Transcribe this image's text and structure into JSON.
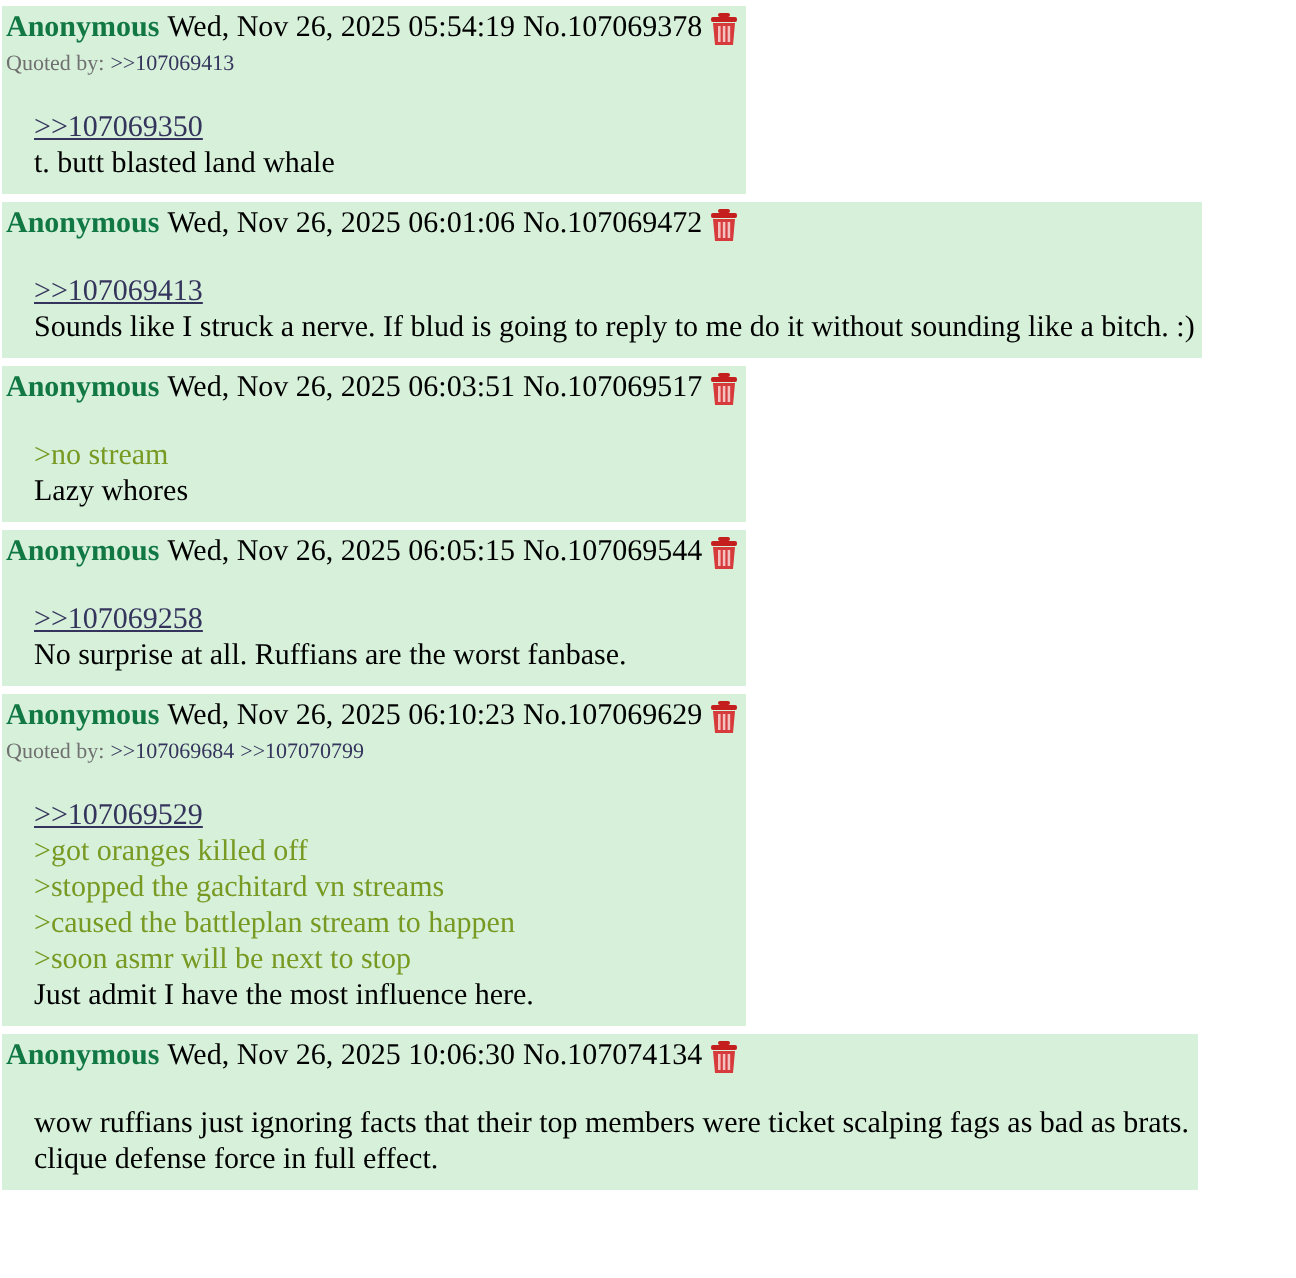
{
  "posts": [
    {
      "name": "Anonymous",
      "date": "Wed, Nov 26, 2025 05:54:19",
      "number": "No.107069378",
      "quoted_by_label": "Quoted by:",
      "quoted_by": [
        ">>107069413"
      ],
      "body": [
        {
          "kind": "quotelink",
          "text": ">>107069350"
        },
        {
          "kind": "text",
          "text": "t. butt blasted land whale"
        }
      ]
    },
    {
      "name": "Anonymous",
      "date": "Wed, Nov 26, 2025 06:01:06",
      "number": "No.107069472",
      "body": [
        {
          "kind": "quotelink",
          "text": ">>107069413"
        },
        {
          "kind": "text",
          "text": "Sounds like I struck a nerve. If blud is going to reply to me do it without sounding like a bitch. :)"
        }
      ]
    },
    {
      "name": "Anonymous",
      "date": "Wed, Nov 26, 2025 06:03:51",
      "number": "No.107069517",
      "body": [
        {
          "kind": "greentext",
          "text": ">no stream"
        },
        {
          "kind": "text",
          "text": "Lazy whores"
        }
      ]
    },
    {
      "name": "Anonymous",
      "date": "Wed, Nov 26, 2025 06:05:15",
      "number": "No.107069544",
      "body": [
        {
          "kind": "quotelink",
          "text": ">>107069258"
        },
        {
          "kind": "text",
          "text": "No surprise at all. Ruffians are the worst fanbase."
        }
      ]
    },
    {
      "name": "Anonymous",
      "date": "Wed, Nov 26, 2025 06:10:23",
      "number": "No.107069629",
      "quoted_by_label": "Quoted by:",
      "quoted_by": [
        ">>107069684",
        ">>107070799"
      ],
      "body": [
        {
          "kind": "quotelink",
          "text": ">>107069529"
        },
        {
          "kind": "greentext",
          "text": ">got oranges killed off"
        },
        {
          "kind": "greentext",
          "text": ">stopped the gachitard vn streams"
        },
        {
          "kind": "greentext",
          "text": ">caused the battleplan stream to happen"
        },
        {
          "kind": "greentext",
          "text": ">soon asmr will be next to stop"
        },
        {
          "kind": "text",
          "text": "Just admit I have the most influence here."
        }
      ]
    },
    {
      "name": "Anonymous",
      "date": "Wed, Nov 26, 2025 10:06:30",
      "number": "No.107074134",
      "body": [
        {
          "kind": "text",
          "text": "wow ruffians just ignoring facts that their top members were ticket scalping fags as bad as brats."
        },
        {
          "kind": "text",
          "text": "clique defense force in full effect."
        }
      ]
    }
  ]
}
